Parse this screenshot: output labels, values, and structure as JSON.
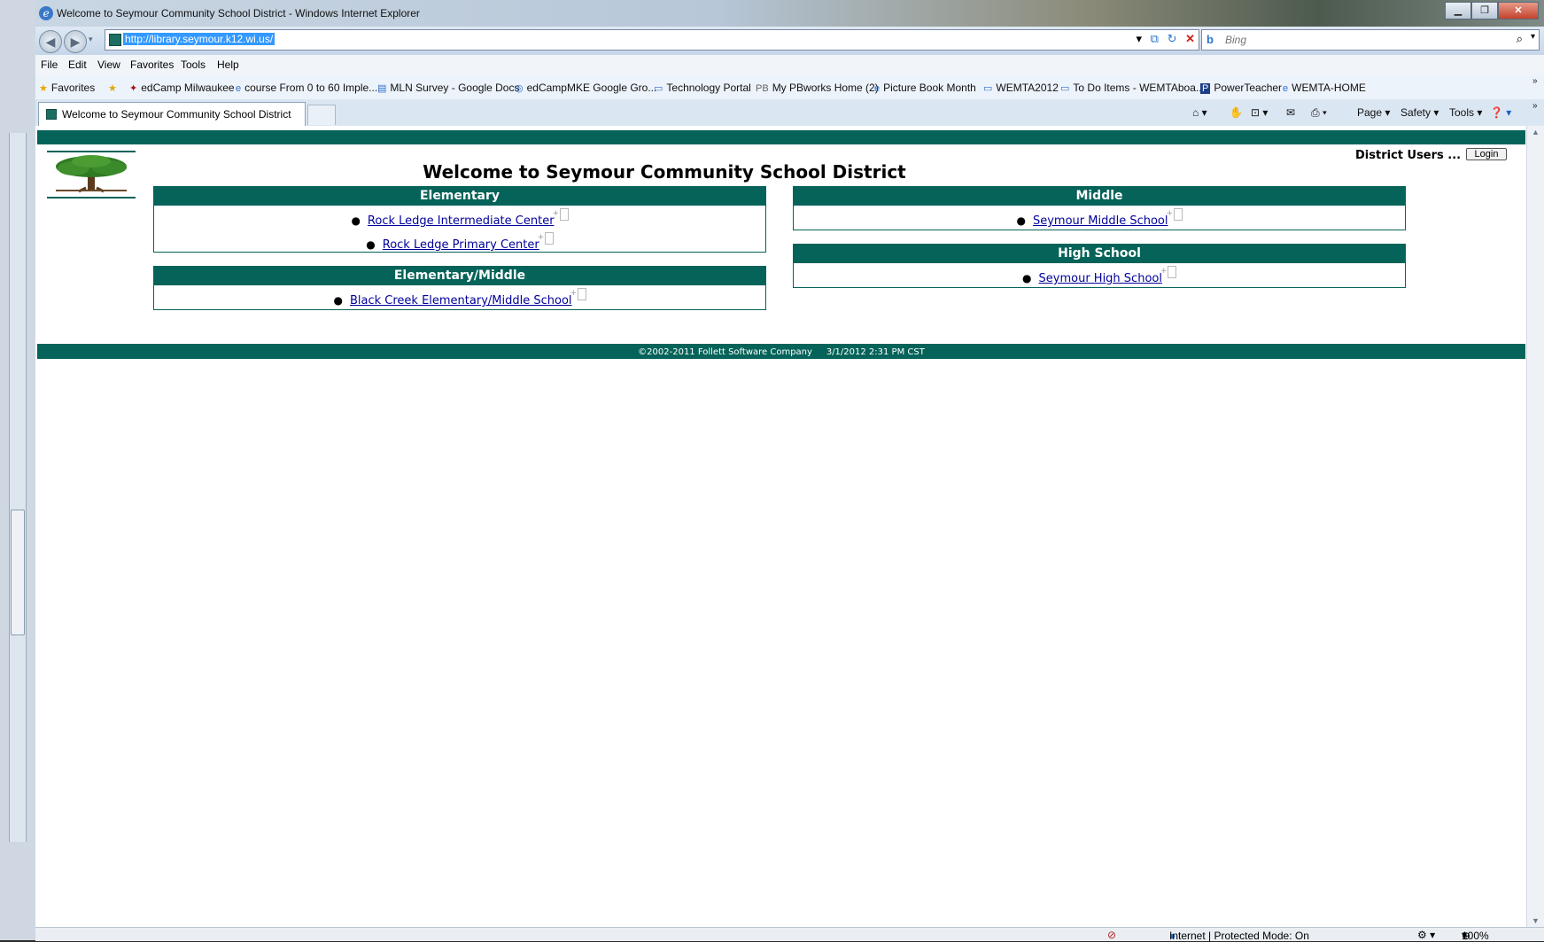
{
  "browser": {
    "window_title": "Welcome to Seymour Community School District - Windows Internet Explorer",
    "address_url": "http://library.seymour.k12.wi.us/",
    "search_placeholder": "Bing",
    "menu": [
      "File",
      "Edit",
      "View",
      "Favorites",
      "Tools",
      "Help"
    ],
    "favorites_label": "Favorites",
    "favorites": [
      "edCamp Milwaukee",
      "course From 0 to 60 Imple...",
      "MLN Survey - Google Docs",
      "edCampMKE Google Gro...",
      "Technology Portal",
      "My PBworks Home (2)",
      "Picture Book Month",
      "WEMTA2012",
      "To Do Items - WEMTAboa...",
      "PowerTeacher",
      "WEMTA-HOME"
    ],
    "tab_title": "Welcome to Seymour Community School District",
    "command_bar": [
      "Page",
      "Safety",
      "Tools"
    ],
    "status_zone": "Internet | Protected Mode: On",
    "zoom": "100%"
  },
  "page": {
    "title": "Welcome to Seymour Community School District",
    "district_users_label": "District Users ...",
    "login_label": "Login",
    "panels": {
      "elementary": {
        "heading": "Elementary",
        "schools": [
          "Rock Ledge Intermediate Center",
          "Rock Ledge Primary Center"
        ]
      },
      "elementary_middle": {
        "heading": "Elementary/Middle",
        "schools": [
          "Black Creek Elementary/Middle School"
        ]
      },
      "middle": {
        "heading": "Middle",
        "schools": [
          "Seymour Middle School"
        ]
      },
      "high_school": {
        "heading": "High School",
        "schools": [
          "Seymour High School"
        ]
      }
    },
    "footer": {
      "copyright": "©2002-2011  Follett Software Company",
      "timestamp": "3/1/2012 2:31 PM CST"
    }
  },
  "colors": {
    "brand_teal": "#056359",
    "link": "#00009c"
  }
}
